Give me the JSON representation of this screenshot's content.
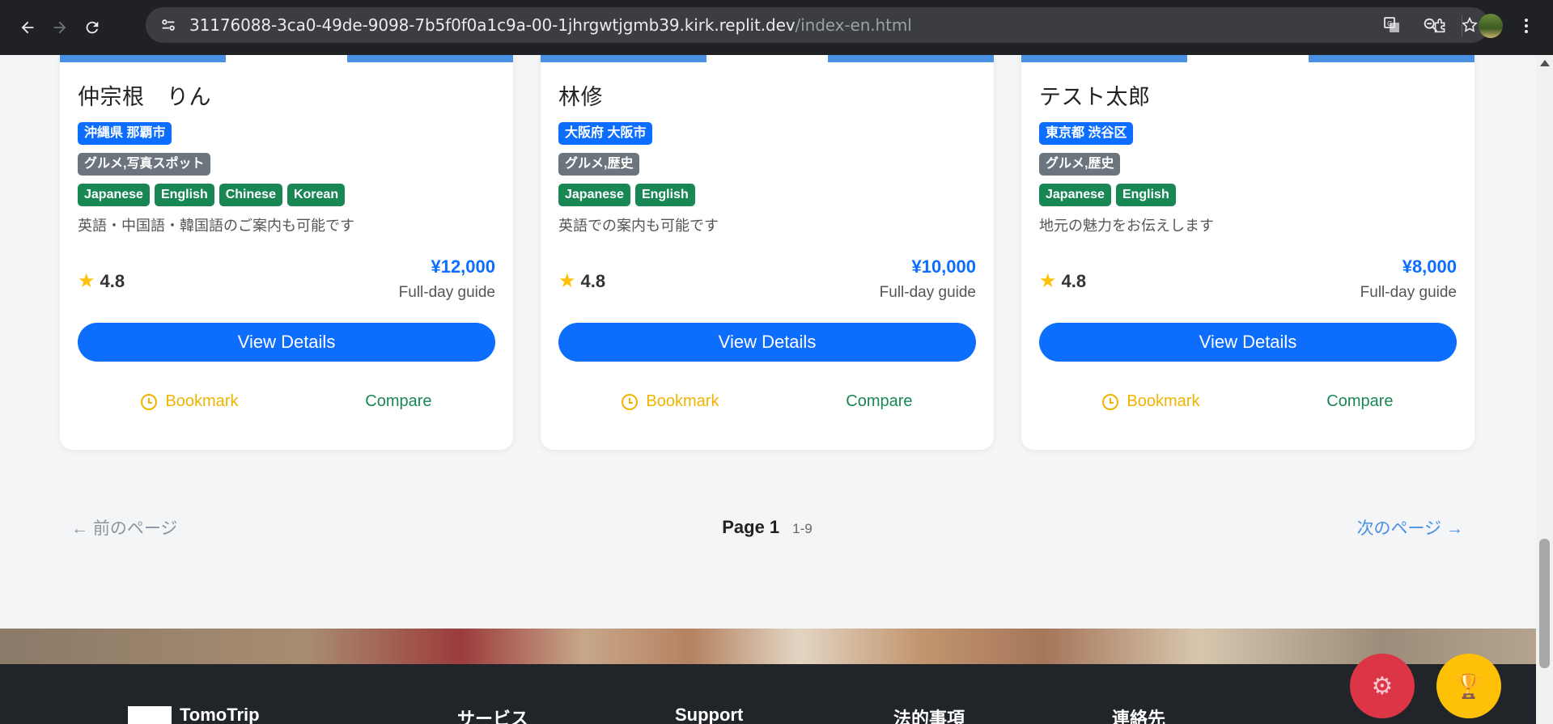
{
  "browser": {
    "url_host": "31176088-3ca0-49de-9098-7b5f0f0a1c9a-00-1jhrgwtjgmb39.kirk.replit.dev",
    "url_path": "/index-en.html",
    "icons": [
      "back-arrow-icon",
      "forward-arrow-icon",
      "reload-icon",
      "site-settings-icon",
      "translate-icon",
      "zoom-icon",
      "star-icon",
      "extensions-icon",
      "profile-avatar",
      "more-vert-icon"
    ]
  },
  "cards": [
    {
      "name": "仲宗根　りん",
      "location": "沖縄県 那覇市",
      "categories": "グルメ,写真スポット",
      "languages": [
        "Japanese",
        "English",
        "Chinese",
        "Korean"
      ],
      "description": "英語・中国語・韓国語のご案内も可能です",
      "rating": "4.8",
      "price": "¥12,000",
      "price_unit": "Full-day guide",
      "view_label": "View Details",
      "bookmark_label": "Bookmark",
      "compare_label": "Compare"
    },
    {
      "name": "林修",
      "location": "大阪府 大阪市",
      "categories": "グルメ,歴史",
      "languages": [
        "Japanese",
        "English"
      ],
      "description": "英語での案内も可能です",
      "rating": "4.8",
      "price": "¥10,000",
      "price_unit": "Full-day guide",
      "view_label": "View Details",
      "bookmark_label": "Bookmark",
      "compare_label": "Compare"
    },
    {
      "name": "テスト太郎",
      "location": "東京都 渋谷区",
      "categories": "グルメ,歴史",
      "languages": [
        "Japanese",
        "English"
      ],
      "description": "地元の魅力をお伝えします",
      "rating": "4.8",
      "price": "¥8,000",
      "price_unit": "Full-day guide",
      "view_label": "View Details",
      "bookmark_label": "Bookmark",
      "compare_label": "Compare"
    }
  ],
  "pagination": {
    "prev_label": "← 前のページ",
    "page_label": "Page 1",
    "range_label": "1-9",
    "next_label": "次のページ →"
  },
  "footer": {
    "col1": "TomoTrip",
    "col2": "サービス",
    "col3": "Support",
    "col4": "法的事項",
    "col5": "連絡先"
  },
  "colors": {
    "primary": "#0d6efd",
    "success": "#198754",
    "secondary": "#6c757d",
    "warning": "#ffc107",
    "danger": "#dc3545",
    "accent_bar": "#4a90e2"
  }
}
